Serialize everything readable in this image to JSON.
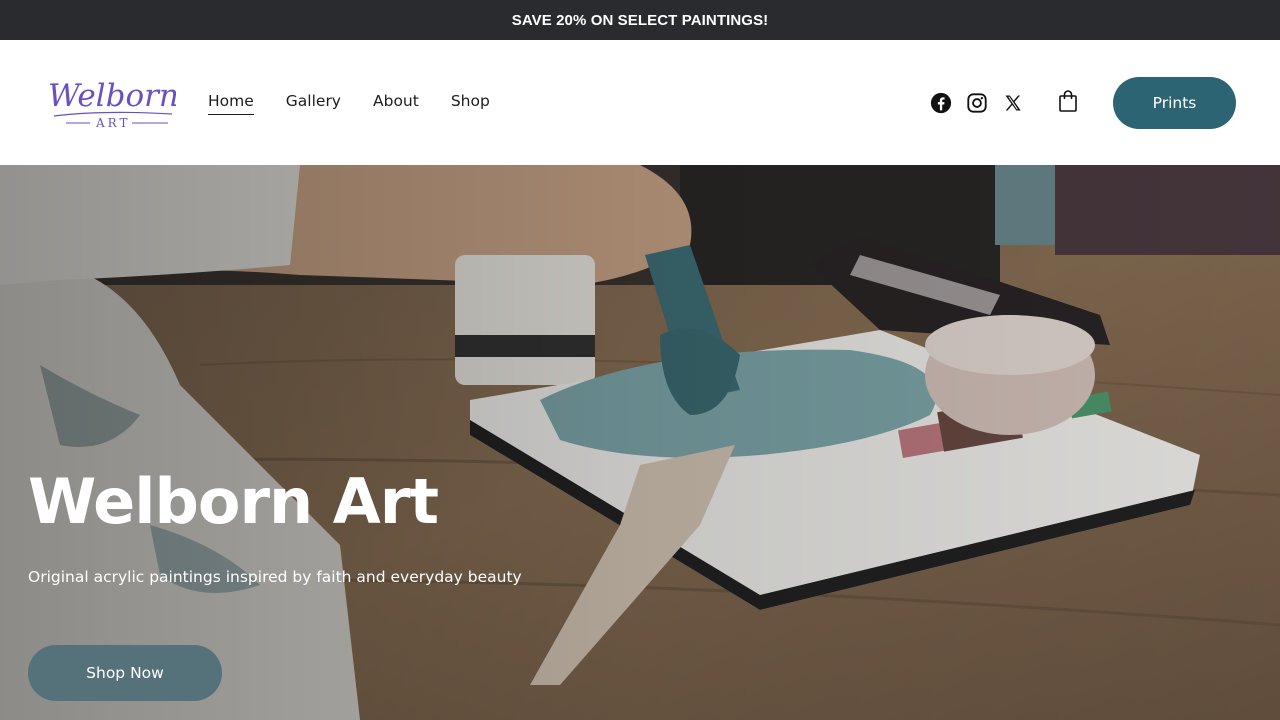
{
  "announcement": "SAVE 20% ON SELECT PAINTINGS!",
  "logo": {
    "line1": "Welborn",
    "line2": "ART"
  },
  "nav": [
    {
      "label": "Home",
      "active": true
    },
    {
      "label": "Gallery",
      "active": false
    },
    {
      "label": "About",
      "active": false
    },
    {
      "label": "Shop",
      "active": false
    }
  ],
  "social_icons": [
    "facebook-icon",
    "instagram-icon",
    "x-icon"
  ],
  "cart_icon": "shopping-bag-icon",
  "prints_button": "Prints",
  "hero": {
    "title": "Welborn Art",
    "subtitle": "Original acrylic paintings inspired by faith and everyday beauty",
    "cta": "Shop Now"
  },
  "colors": {
    "announcement_bg": "#2a2b2e",
    "accent": "#2d6474",
    "cta_bg": "#55717a",
    "logo": "#6b4fc4"
  }
}
